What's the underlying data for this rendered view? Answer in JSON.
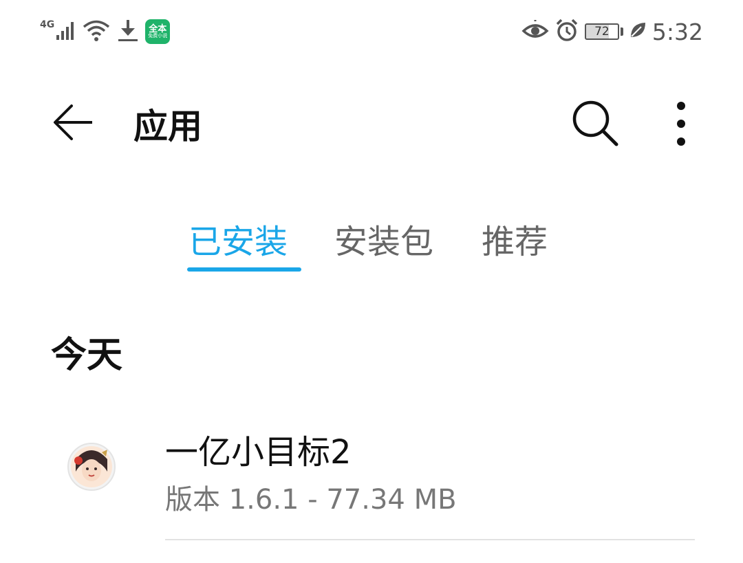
{
  "status_bar": {
    "network_type": "4G",
    "notification_app_badge": "全本",
    "notification_app_badge_sub": "免费小说",
    "battery_level": "72",
    "time": "5:32",
    "icons": [
      "signal-icon",
      "wifi-icon",
      "download-icon",
      "app-badge-icon",
      "eye-comfort-icon",
      "alarm-icon",
      "battery-icon",
      "power-saving-leaf-icon"
    ]
  },
  "app_bar": {
    "title": "应用",
    "back_icon": "back-arrow-icon",
    "search_icon": "search-icon",
    "more_icon": "more-vertical-icon"
  },
  "tabs": [
    {
      "label": "已安装",
      "active": true
    },
    {
      "label": "安装包",
      "active": false
    },
    {
      "label": "推荐",
      "active": false
    }
  ],
  "colors": {
    "accent": "#1aa6e8",
    "text_primary": "#111111",
    "text_secondary": "#777777"
  },
  "sections": [
    {
      "title": "今天",
      "apps": [
        {
          "name": "一亿小目标2",
          "meta": "版本 1.6.1 - 77.34 MB"
        }
      ]
    }
  ]
}
